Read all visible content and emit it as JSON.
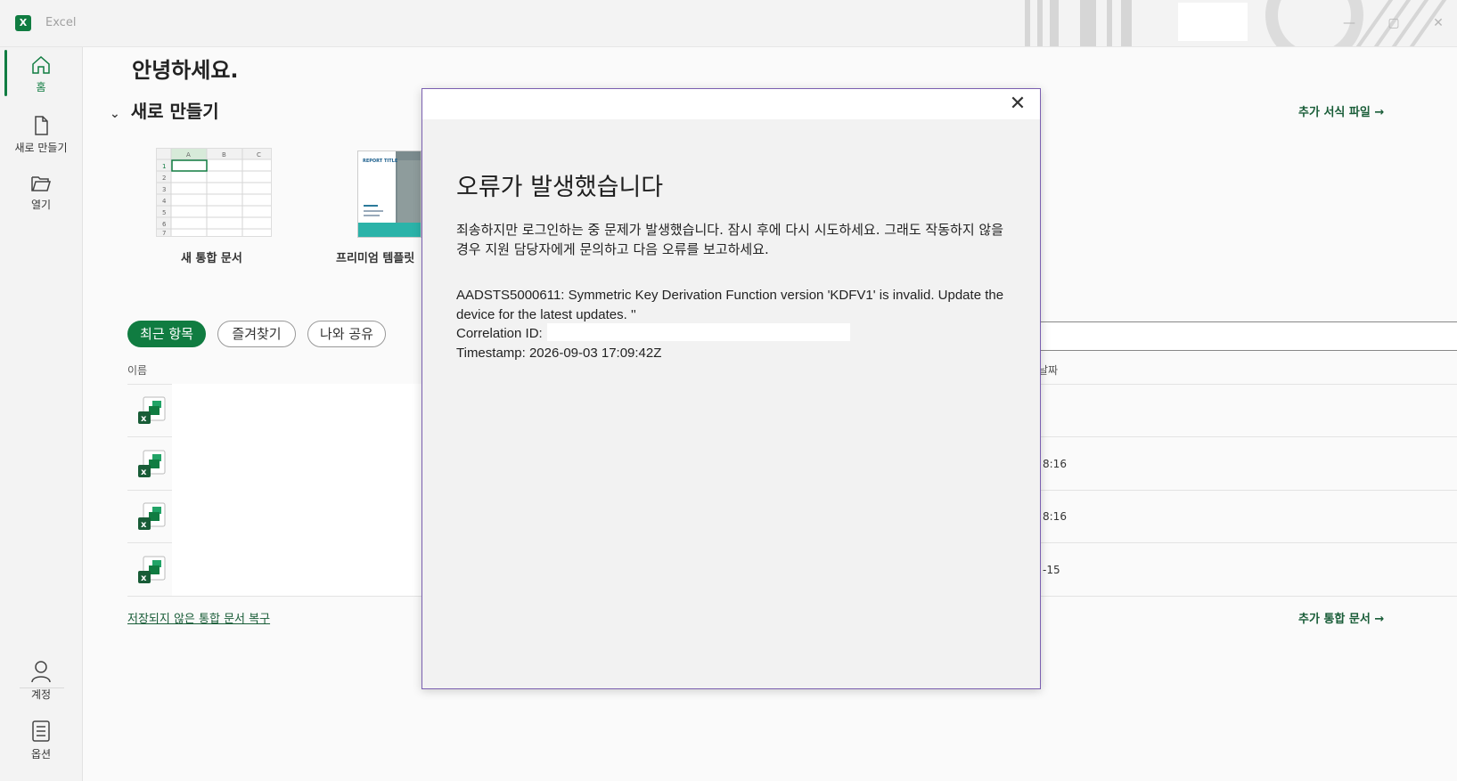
{
  "window": {
    "app_name": "Excel",
    "logo_glyph": "X",
    "minimize_glyph": "—",
    "maximize_glyph": "▢",
    "close_glyph": "✕"
  },
  "sidebar": {
    "items": [
      {
        "label": "홈",
        "icon": "home-icon",
        "active": true
      },
      {
        "label": "새로 만들기",
        "icon": "new-document-icon"
      },
      {
        "label": "열기",
        "icon": "folder-open-icon"
      }
    ],
    "bottom_items": [
      {
        "label": "계정",
        "icon": "person-icon"
      },
      {
        "label": "옵션",
        "icon": "options-icon"
      }
    ]
  },
  "home": {
    "greeting": "안녕하세요.",
    "new_section": {
      "title": "새로 만들기",
      "more_templates": "추가 서식 파일 →",
      "templates": [
        {
          "label": "새 통합 문서"
        },
        {
          "label": "프리미엄 템플릿",
          "thumb_title": "REPORT TITLE"
        }
      ]
    },
    "tabs": [
      "최근 항목",
      "즐겨찾기",
      "나와 공유"
    ],
    "columns": {
      "name": "이름",
      "date": "날짜"
    },
    "rows": [
      {
        "date": ""
      },
      {
        "date": "8:16"
      },
      {
        "date": "8:16"
      },
      {
        "date": "-15"
      }
    ],
    "recover_link": "저장되지 않은 통합 문서 복구",
    "more_workbooks": "추가 통합 문서 →"
  },
  "dialog": {
    "close_glyph": "✕",
    "title": "오류가 발생했습니다",
    "message": "죄송하지만 로그인하는 중 문제가 발생했습니다. 잠시 후에 다시 시도하세요. 그래도 작동하지 않을 경우 지원 담당자에게 문의하고 다음 오류를 보고하세요.",
    "error_text": "AADSTS5000611: Symmetric Key Derivation Function version 'KDFV1' is invalid. Update the device for the latest updates. ''",
    "correlation_label": "Correlation ID:",
    "timestamp": "Timestamp: 2026-09-03 17:09:42Z"
  },
  "colors": {
    "accent": "#107c41",
    "link": "#185c37",
    "dialog_border": "#7a5fb0"
  }
}
